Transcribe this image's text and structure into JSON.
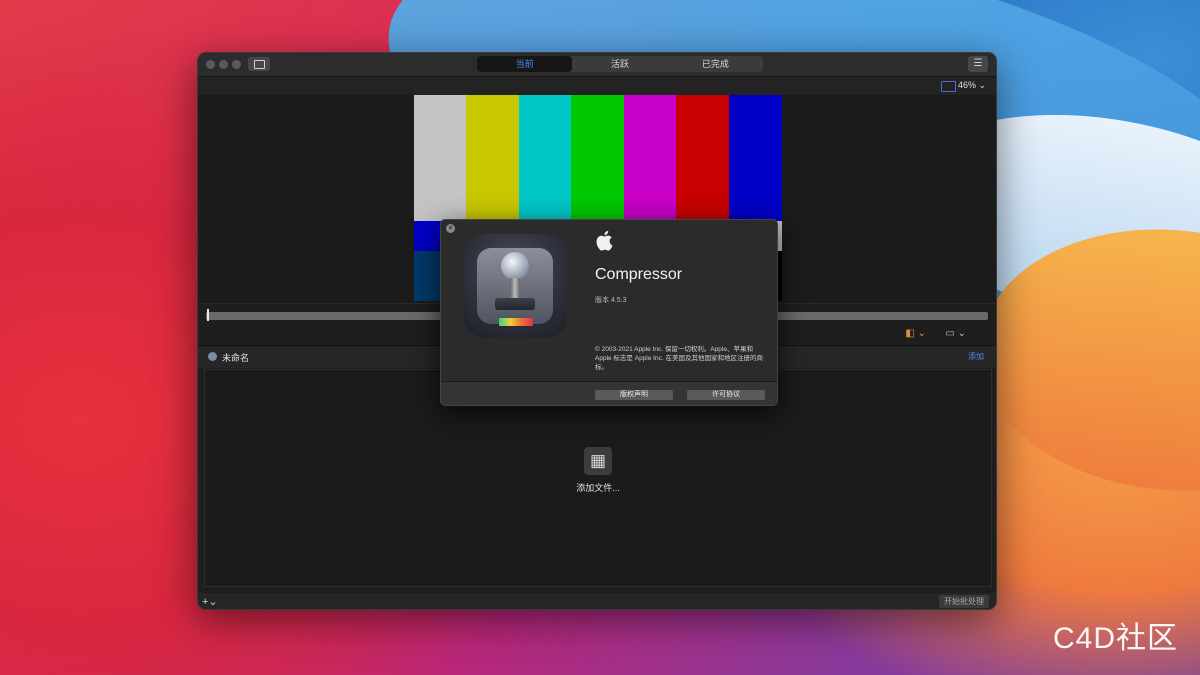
{
  "window": {
    "tabs": [
      "当前",
      "活跃",
      "已完成"
    ],
    "active_tab": 0
  },
  "viewer": {
    "zoom": "46%",
    "color_bars": [
      "#c0c0c0",
      "#c0c000",
      "#00c0c0",
      "#00c000",
      "#c000c0",
      "#c00000",
      "#0000c0"
    ]
  },
  "batch": {
    "title": "未命名",
    "add_label": "添加",
    "add_file_label": "添加文件...",
    "start_button": "开始批处理"
  },
  "about": {
    "app_name": "Compressor",
    "version": "版本 4.5.3",
    "copyright": "© 2003-2021 Apple Inc. 保留一切权利。Apple、苹果和 Apple 标志是 Apple Inc. 在美国及其他国家和地区注册的商标。",
    "buttons": [
      "版权声明",
      "许可协议"
    ]
  },
  "watermark": "C4D社区"
}
